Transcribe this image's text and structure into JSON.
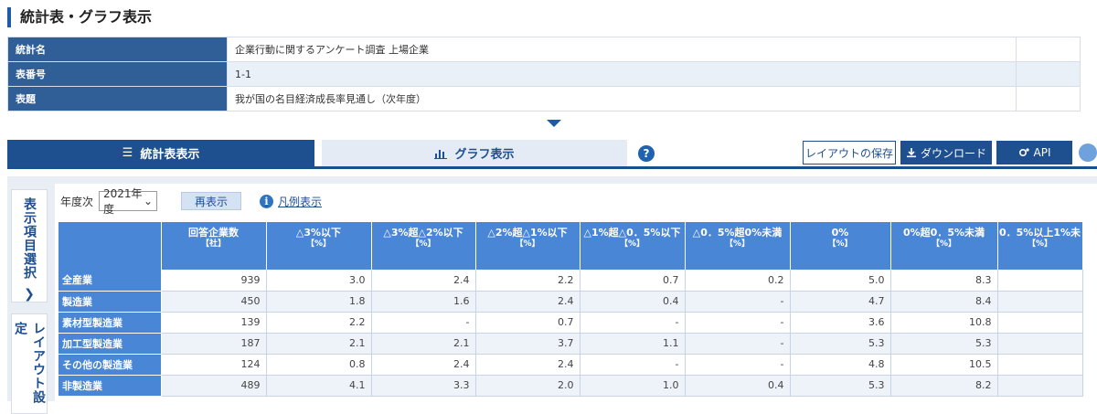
{
  "page_title": "統計表・グラフ表示",
  "info": [
    {
      "label": "統計名",
      "value": "企業行動に関するアンケート調査 上場企業"
    },
    {
      "label": "表番号",
      "value": "1-1"
    },
    {
      "label": "表題",
      "value": "我が国の名目経済成長率見通し（次年度）"
    }
  ],
  "tabs": {
    "table": "統計表表示",
    "graph": "グラフ表示"
  },
  "buttons": {
    "layout_save": "レイアウトの保存",
    "download": "ダウンロード",
    "api": "API",
    "help": "?"
  },
  "side_tabs": {
    "items": "表示項目選択",
    "layout": "レイアウト設定"
  },
  "controls": {
    "year_label": "年度次",
    "year_value": "2021年度",
    "refresh": "再表示",
    "legend": "凡例表示"
  },
  "table": {
    "columns": [
      {
        "label": "回答企業数",
        "unit": "【社】"
      },
      {
        "label": "△3%以下",
        "unit": "【%】"
      },
      {
        "label": "△3%超△2%以下",
        "unit": "【%】"
      },
      {
        "label": "△2%超△1%以下",
        "unit": "【%】"
      },
      {
        "label": "△1%超△0．5%以下",
        "unit": "【%】"
      },
      {
        "label": "△0．5%超0%未満",
        "unit": "【%】"
      },
      {
        "label": "0%",
        "unit": "【%】"
      },
      {
        "label": "0%超0．5%未満",
        "unit": "【%】"
      },
      {
        "label": "0．5%以上1%未",
        "unit": "【%】"
      }
    ],
    "rows": [
      {
        "label": "全産業",
        "values": [
          "939",
          "3.0",
          "2.4",
          "2.2",
          "0.7",
          "0.2",
          "5.0",
          "8.3",
          ""
        ]
      },
      {
        "label": "製造業",
        "values": [
          "450",
          "1.8",
          "1.6",
          "2.4",
          "0.4",
          "-",
          "4.7",
          "8.4",
          ""
        ]
      },
      {
        "label": "素材型製造業",
        "values": [
          "139",
          "2.2",
          "-",
          "0.7",
          "-",
          "-",
          "3.6",
          "10.8",
          ""
        ]
      },
      {
        "label": "加工型製造業",
        "values": [
          "187",
          "2.1",
          "2.1",
          "3.7",
          "1.1",
          "-",
          "5.3",
          "5.3",
          ""
        ]
      },
      {
        "label": "その他の製造業",
        "values": [
          "124",
          "0.8",
          "2.4",
          "2.4",
          "-",
          "-",
          "4.8",
          "10.5",
          ""
        ]
      },
      {
        "label": "非製造業",
        "values": [
          "489",
          "4.1",
          "3.3",
          "2.0",
          "1.0",
          "0.4",
          "5.3",
          "8.2",
          ""
        ]
      }
    ]
  },
  "colors": {
    "primary": "#1e4f8f",
    "header": "#4a86d6",
    "label_cell": "#2f5f96"
  }
}
